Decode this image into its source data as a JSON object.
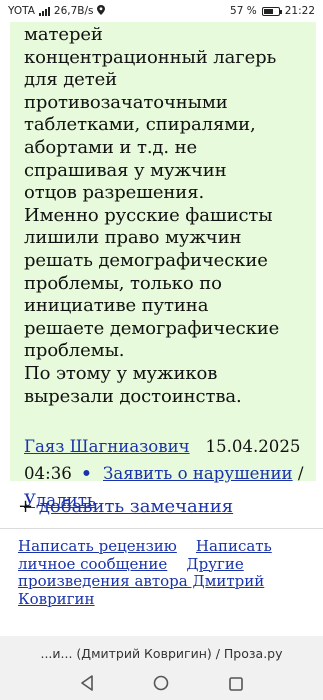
{
  "status_bar": {
    "carrier": "YOTA",
    "speed": "26,7B/s",
    "battery": "57 %",
    "time": "21:22"
  },
  "comment": {
    "lines": [
      "матерей",
      "концентрационный лагерь",
      "для детей",
      "противозачаточными",
      "таблетками, спиралями,",
      "абортами и т.д. не",
      "спрашивая у мужчин",
      "отцов разрешения.",
      "Именно русские фашисты",
      "лишили право мужчин",
      "решать демографические",
      "проблемы, только по",
      "инициативе путина",
      "решаете демографические",
      "проблемы.",
      "По этому у мужиков",
      "вырезали достоинства."
    ],
    "author": "Гаяз Шагниазович",
    "date": "15.04.2025",
    "time": "04:36",
    "bullet": "•",
    "report_link": "Заявить о нарушении",
    "separator": "/",
    "delete_link": "Удалить"
  },
  "add_note": {
    "plus": "+",
    "link": "добавить замечания"
  },
  "bottom_links": {
    "write_review": "Написать рецензию",
    "write_message": "Написать личное сообщение",
    "other_works": "Другие произведения автора Дмитрий Ковригин"
  },
  "browser": {
    "address": "...и... (Дмитрий Ковригин) / Проза.ру"
  },
  "colors": {
    "comment_bg": "#e7fadb",
    "link": "#1a33aa"
  }
}
